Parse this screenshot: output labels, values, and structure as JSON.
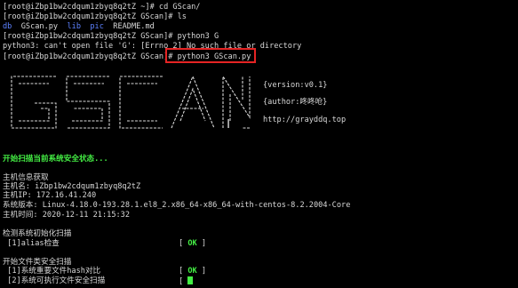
{
  "lines": {
    "l1": "[root@iZbp1bw2cdqum1zbyq8q2tZ ~]# cd GScan/",
    "l2": "[root@iZbp1bw2cdqum1zbyq8q2tZ GScan]# ls",
    "ls": {
      "db": "db",
      "gscan_py": "GScan.py",
      "lib": "lib",
      "pic": "pic",
      "readme": "README.md"
    },
    "l4": "[root@iZbp1bw2cdqum1zbyq8q2tZ GScan]# python3 G",
    "l5": "python3: can't open file 'G': [Errno 2] No such file or directory",
    "l6_prompt": "[root@iZbp1bw2cdqum1zbyq8q2tZ GScan]# ",
    "l6_cmd": "python3 GScan.py"
  },
  "banner": {
    "version": "{version:v0.1}",
    "author": "{author:咚咚呛}",
    "url": "http://grayddq.top"
  },
  "scan": {
    "start": "开始扫描当前系统安全状态...",
    "host_header": "主机信息获取",
    "hostname": "主机名: iZbp1bw2cdqum1zbyq8q2tZ",
    "ip": "主机IP: 172.16.41.240",
    "version": "系统版本: Linux-4.18.0-193.28.1.el8_2.x86_64-x86_64-with-centos-8.2.2004-Core",
    "time": "主机时间: 2020-12-11 21:15:32",
    "init_header": "检测系统初始化扫描",
    "alias_item": " [1]alias检查",
    "file_header": "开始文件类安全扫描",
    "file_item1": " [1]系统重要文件hash对比",
    "file_item2": " [2]系统可执行文件安全扫描",
    "bracket_open": "[",
    "bracket_close": "]",
    "ok": "OK"
  },
  "colors": {
    "background": "#000000",
    "text": "#d8d8d8",
    "directory": "#5d82ff",
    "success": "#44ee44",
    "highlight_box": "#e52424"
  }
}
